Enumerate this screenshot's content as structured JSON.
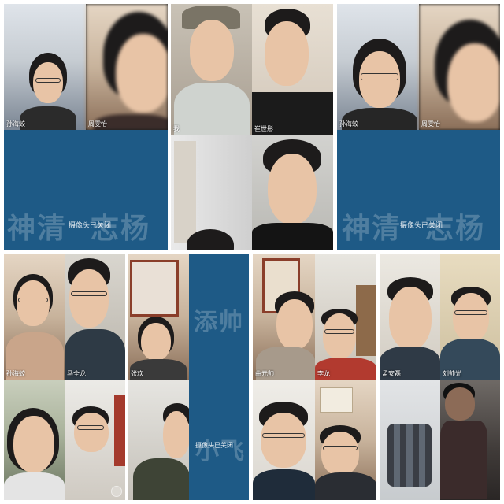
{
  "colors": {
    "camera_off_bg": "#1e5a86",
    "watermark": "rgba(255,255,255,0.22)",
    "name_text": "#ffffff"
  },
  "panels": {
    "p1": {
      "tiles": [
        {
          "name": "孙海蛟"
        },
        {
          "name": "周雯怡"
        }
      ],
      "watermark_left": "神清",
      "watermark_right": "志杨",
      "camera_off": "摄像头已关闭"
    },
    "p2": {
      "tiles": [
        {
          "name": "我"
        },
        {
          "name": "崔世彤"
        }
      ]
    },
    "p3": {
      "tiles": [
        {
          "name": "孙海蛟"
        },
        {
          "name": "周雯怡"
        }
      ],
      "watermark_left": "神清",
      "watermark_right": "志杨",
      "camera_off": "摄像头已关闭"
    },
    "p4": {
      "tiles": [
        {
          "name": "孙海蛟"
        },
        {
          "name": "马全龙"
        }
      ]
    },
    "p5": {
      "watermark_top": "添帅",
      "watermark_bottom": "小飞",
      "camera_off": "摄像头已关闭",
      "tiles": [
        {
          "name": "张欢"
        }
      ]
    },
    "p6": {
      "tiles": [
        {
          "name": "曲元帅"
        },
        {
          "name": "李龙"
        }
      ]
    },
    "p7": {
      "tiles": [
        {
          "name": "孟安磊"
        },
        {
          "name": "刘帅光"
        }
      ]
    }
  }
}
